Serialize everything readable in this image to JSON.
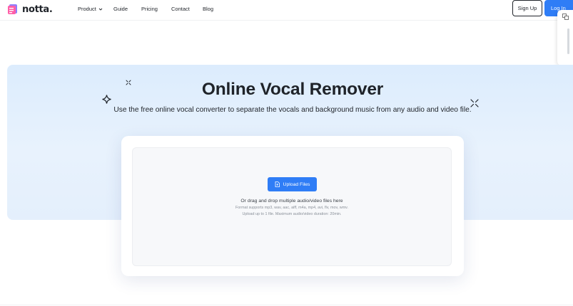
{
  "header": {
    "logo_text": "notta.",
    "nav": {
      "product": "Product",
      "guide": "Guide",
      "pricing": "Pricing",
      "contact": "Contact",
      "blog": "Blog"
    },
    "signup_label": "Sign Up",
    "login_label": "Log In"
  },
  "hero": {
    "title": "Online Vocal Remover",
    "subtitle": "Use the free online vocal converter to separate the vocals and background music from any audio and video file."
  },
  "upload": {
    "button_label": "Upload Files",
    "drop_text": "Or drag and drop multiple audio/video files here",
    "formats_text": "Format supports mp3, wav, aac, aiff, m4a, mp4, avi, flv, mov, wmv.",
    "limits_text": "Upload up to 1 file. Maximum audio/video duration: 20min."
  },
  "colors": {
    "accent": "#2f7df6",
    "hero_bg": "#e3effd",
    "text": "#1f2329"
  },
  "icons": {
    "logo": "notta-logo-icon",
    "product_chevron": "chevron-down-icon",
    "upload": "upload-file-icon",
    "sparkles": "sparkle-icon",
    "side_panel": "translate-icon"
  }
}
